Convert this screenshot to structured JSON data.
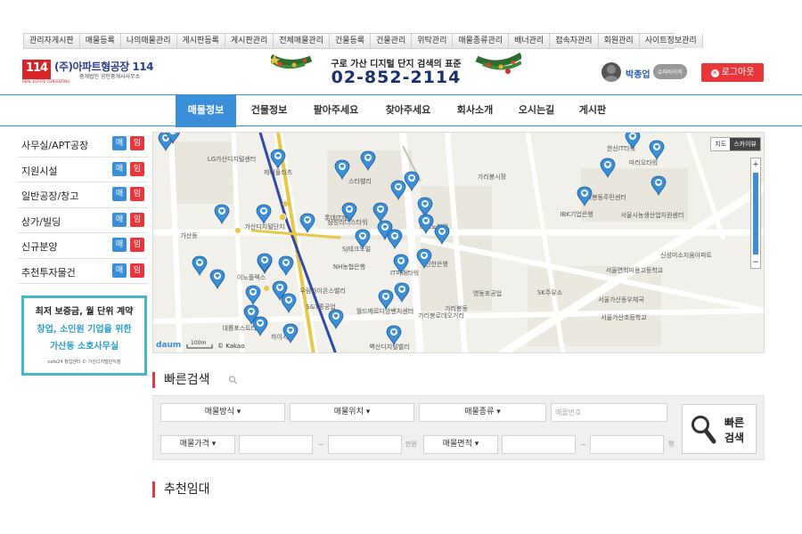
{
  "admin_bar": [
    "관리자게시판",
    "매물등록",
    "나의매물관리",
    "게시판등록",
    "게시판관리",
    "전체매물관리",
    "건물등록",
    "건물관리",
    "위탁관리",
    "매물종류관리",
    "배너관리",
    "접속자관리",
    "회원관리",
    "사이트정보관리"
  ],
  "logo": {
    "mark": "114",
    "name": "(주)아파트형공장 114",
    "sub": "중개법인 공인중개사사무소",
    "tiny": "REAL ESTATE CONSULTING"
  },
  "banner": {
    "line1": "구로 가산 디지털 단지 검색의 표준",
    "phone": "02-852-2114"
  },
  "user": {
    "name": "박종업",
    "badge": "슈퍼바이저",
    "logout": "로그아웃"
  },
  "nav": [
    "매물정보",
    "건물정보",
    "팔아주세요",
    "찾아주세요",
    "회사소개",
    "오시는길",
    "게시판"
  ],
  "categories": [
    {
      "label": "사무실/APT공장"
    },
    {
      "label": "지원시설"
    },
    {
      "label": "일반공장/창고"
    },
    {
      "label": "상가/빌딩"
    },
    {
      "label": "신규분양"
    },
    {
      "label": "추천투자물건"
    }
  ],
  "cat_buttons": {
    "sale": "매",
    "rent": "임"
  },
  "ad": {
    "line1": "최저 보증금, 월 단위 계약",
    "line2": "창업, 소인원 기업을 위한",
    "line3": "가산동 소호사무실",
    "line4": "cafe24 창업센터 © 가산디지털단지점"
  },
  "map": {
    "type_buttons": [
      "지도",
      "스카이뷰"
    ],
    "scale": "100m",
    "copyright": "© Kakao",
    "brand": "daum",
    "labels": [
      "LG가산디지털센터",
      "제이플라츠",
      "스타밸리",
      "가리봉시장",
      "한신IT타워",
      "마리오타워",
      "가리봉동주민센터",
      "IBK기업은행",
      "서울시농생산업지원센터",
      "롯데IT캐슬",
      "삼성리더스타워",
      "SJ테크노빌",
      "테크노타워",
      "신한은행",
      "서울연희미용고등학교",
      "신성미소지움아파트",
      "우림라이온스밸리",
      "이노플렉스",
      "IT미래타워",
      "영동포공업",
      "SK주유소",
      "서울가산동우체국",
      "NH농협은행",
      "S&T중공업",
      "월드메르디앙벤처센터",
      "가리봉로데오거리",
      "서울가산초등학교",
      "하이시티",
      "벽산디지털밸리",
      "대륭포스트타워",
      "가리봉동",
      "가산디지털단지",
      "가산동"
    ]
  },
  "quick_search": {
    "title": "빠른검색",
    "type": "매물방식",
    "location": "매물위치",
    "kind": "매물종류",
    "number_placeholder": "매물번호",
    "price": "매물가격",
    "price_unit": "만원",
    "area": "매물면적",
    "area_unit": "평",
    "dash": "~",
    "search_button": [
      "빠른",
      "검색"
    ]
  },
  "recommended_title": "추천임대",
  "colors": {
    "accent_blue": "#3a8fd8",
    "accent_red": "#e8363a",
    "pin": "#3a8fd8",
    "ad_border": "#4ab4c8"
  },
  "icons": [
    "x-circle-icon",
    "search-icon",
    "magnifier-icon",
    "map-pin-icon",
    "caret-down-icon",
    "avatar-icon"
  ]
}
